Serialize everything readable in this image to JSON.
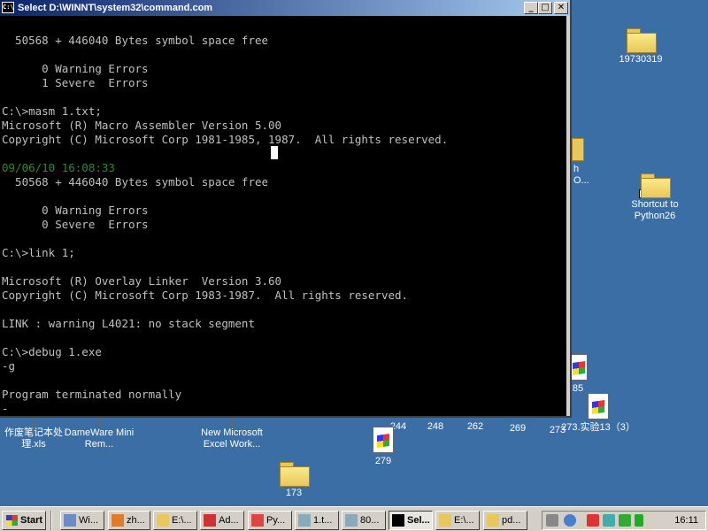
{
  "window": {
    "title": "Select D:\\WINNT\\system32\\command.com",
    "minimize_label": "_",
    "maximize_label": "□",
    "close_label": "✕",
    "icon_label": "C:\\"
  },
  "console": {
    "lines": [
      "  50568 + 446040 Bytes symbol space free",
      "",
      "      0 Warning Errors",
      "      1 Severe  Errors",
      "",
      "C:\\>masm 1.txt;",
      "Microsoft (R) Macro Assembler Version 5.00",
      "Copyright (C) Microsoft Corp 1981-1985, 1987.  All rights reserved.",
      "",
      "09/06/10 16:08:33",
      "  50568 + 446040 Bytes symbol space free",
      "",
      "      0 Warning Errors",
      "      0 Severe  Errors",
      "",
      "C:\\>link 1;",
      "",
      "Microsoft (R) Overlay Linker  Version 3.60",
      "Copyright (C) Microsoft Corp 1983-1987.  All rights reserved.",
      "",
      "LINK : warning L4021: no stack segment",
      "",
      "C:\\>debug 1.exe",
      "-g",
      "",
      "Program terminated normally",
      "-"
    ],
    "timestamp_line_index": 9,
    "text_color": "#c0c0c0",
    "timestamp_color": "#2c8a2c"
  },
  "desktop_icons": [
    {
      "label": "19730319",
      "type": "folder"
    },
    {
      "label": "h O...",
      "type": "folder-partial"
    },
    {
      "label": "Shortcut to Python26",
      "type": "folder-shortcut"
    },
    {
      "label": "作废笔记本处理.xls",
      "type": "excel"
    },
    {
      "label": "DameWare Mini Rem...",
      "type": "shortcut"
    },
    {
      "label": "New Microsoft Excel Work...",
      "type": "excel"
    },
    {
      "label": "173",
      "type": "folder"
    },
    {
      "label": "244",
      "type": "file"
    },
    {
      "label": "248",
      "type": "file"
    },
    {
      "label": "262",
      "type": "file"
    },
    {
      "label": "269",
      "type": "file"
    },
    {
      "label": "273",
      "type": "file"
    },
    {
      "label": "279",
      "type": "file"
    },
    {
      "label": "85",
      "type": "file-partial"
    },
    {
      "label": "273.实验13（3）",
      "type": "file"
    }
  ],
  "taskbar": {
    "start_label": "Start",
    "tasks": [
      {
        "label": "Wi...",
        "icon": "window-icon",
        "active": false
      },
      {
        "label": "zh...",
        "icon": "firefox-icon",
        "active": false
      },
      {
        "label": "E:\\...",
        "icon": "folder-icon",
        "active": false
      },
      {
        "label": "Ad...",
        "icon": "acrobat-icon",
        "active": false
      },
      {
        "label": "Py...",
        "icon": "python-icon",
        "active": false
      },
      {
        "label": "1.t...",
        "icon": "notepad-icon",
        "active": false
      },
      {
        "label": "80...",
        "icon": "notepad-icon",
        "active": false
      },
      {
        "label": "Sel...",
        "icon": "console-icon",
        "active": true
      },
      {
        "label": "E:\\...",
        "icon": "folder-icon",
        "active": false
      },
      {
        "label": "pd...",
        "icon": "folder-icon",
        "active": false
      }
    ],
    "clock": "16:11"
  },
  "colors": {
    "desktop": "#3a6ea5",
    "title_active": "#0a246a",
    "console_bg": "#000000"
  }
}
